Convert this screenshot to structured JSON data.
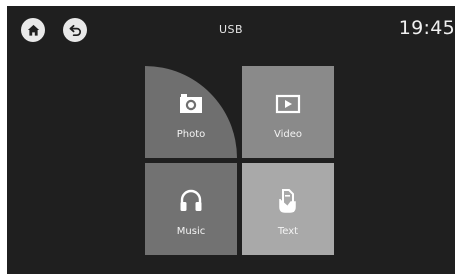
{
  "header": {
    "title": "USB",
    "clock": "19:45",
    "home_icon": "home-icon",
    "back_icon": "back-arrow-icon"
  },
  "tiles": [
    {
      "label": "Photo",
      "icon": "camera-icon"
    },
    {
      "label": "Video",
      "icon": "play-screen-icon"
    },
    {
      "label": "Music",
      "icon": "headphones-icon"
    },
    {
      "label": "Text",
      "icon": "hand-document-icon"
    }
  ]
}
